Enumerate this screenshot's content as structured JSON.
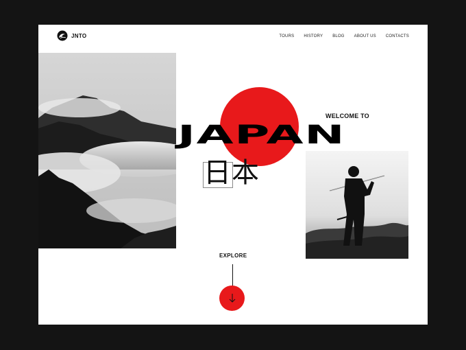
{
  "brand": "JNTO",
  "nav": {
    "items": [
      {
        "label": "TOURS"
      },
      {
        "label": "HISTORY"
      },
      {
        "label": "BLOG"
      },
      {
        "label": "ABOUT US"
      },
      {
        "label": "CONTACTS"
      }
    ]
  },
  "hero": {
    "welcome": "WELCOME TO",
    "title": "JAPAN",
    "kanji": "日本"
  },
  "explore": {
    "label": "EXPLORE",
    "button_icon": "arrow-down-icon"
  },
  "colors": {
    "accent": "#e8191b",
    "background": "#141414",
    "page": "#ffffff"
  },
  "icons": {
    "logo": "wave-crest-icon"
  }
}
